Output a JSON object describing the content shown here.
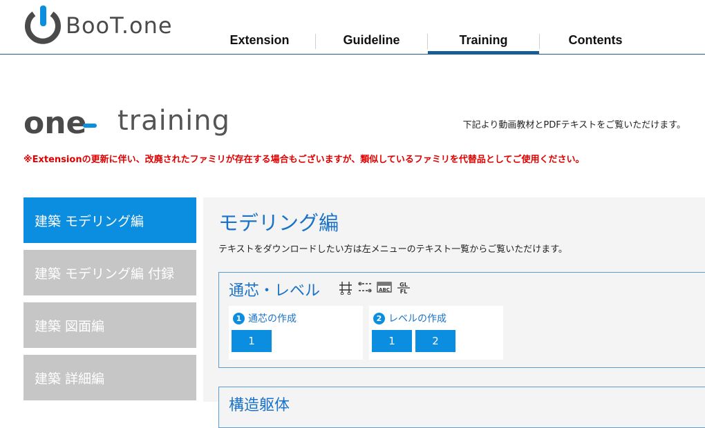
{
  "logo": {
    "text": "BooT.one"
  },
  "nav": {
    "items": [
      {
        "label": "Extension"
      },
      {
        "label": "Guideline"
      },
      {
        "label": "Training",
        "active": true
      },
      {
        "label": "Contents"
      }
    ]
  },
  "hero": {
    "brand_one": "one",
    "brand_training": "training",
    "intro": "下記より動画教材とPDFテキストをご覧いただけます。",
    "notice": "※Extensionの更新に伴い、改廃されたファミリが存在する場合もございますが、類似しているファミリを代替品としてご使用ください。"
  },
  "sidebar": {
    "items": [
      {
        "label": "建築 モデリング編",
        "active": true
      },
      {
        "label": "建築 モデリング編 付録"
      },
      {
        "label": "建築 図面編"
      },
      {
        "label": "建築 詳細編"
      }
    ]
  },
  "main": {
    "title": "モデリング編",
    "description": "テキストをダウンロードしたい方は左メニューのテキスト一覧からご覧いただけます。",
    "sections": [
      {
        "title": "通芯・レベル",
        "icons": [
          "grid-tool-icon",
          "level-tool-icon",
          "abc-label-icon",
          "level-label-icon"
        ],
        "cards": [
          {
            "number": "1",
            "title": "通芯の作成",
            "buttons": [
              "1"
            ]
          },
          {
            "number": "2",
            "title": "レベルの作成",
            "buttons": [
              "1",
              "2"
            ]
          }
        ]
      },
      {
        "title": "構造躯体"
      }
    ]
  },
  "colors": {
    "accent": "#0c8ee0",
    "nav_underline": "#1a5c96",
    "heading_blue": "#1a73c8",
    "notice_red": "#e00000",
    "sidebar_inactive": "#c6c6c6"
  }
}
